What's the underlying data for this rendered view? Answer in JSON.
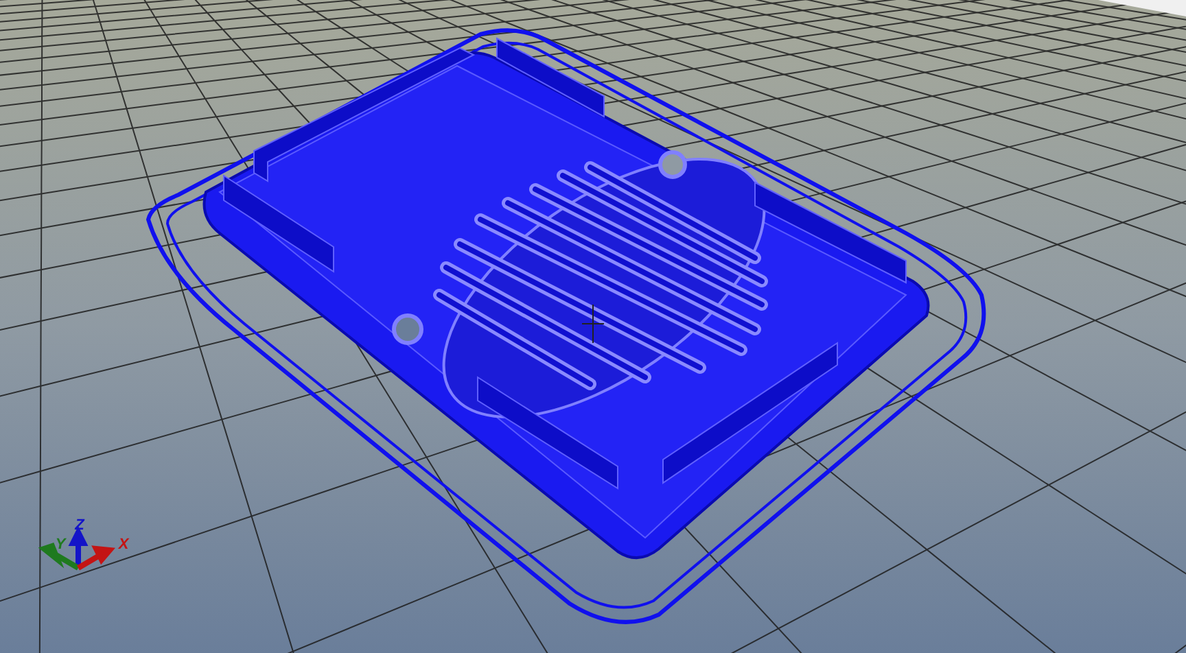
{
  "axes": [
    {
      "label": "Y",
      "color": "#1f7a1f"
    },
    {
      "label": "Z",
      "color": "#1414c8"
    },
    {
      "label": "X",
      "color": "#c41414"
    }
  ]
}
